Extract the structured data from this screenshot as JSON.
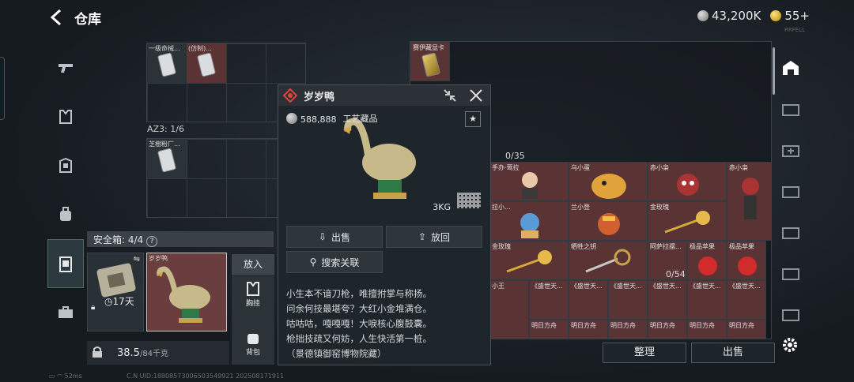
{
  "header": {
    "title": "仓库",
    "silver": "43,200K",
    "gold": "55+"
  },
  "nav": {
    "items": [
      "weapon-icon",
      "armor-icon",
      "vest-icon",
      "backpack-icon",
      "container-icon",
      "case-icon"
    ]
  },
  "containers": {
    "top_slot_labels": [
      "一级命械...",
      "(仿制)..."
    ],
    "az_capacity": "AZ3: 1/6",
    "mid_slot_label": "芝樹粉厂...",
    "safe_title": "安全箱: 4/4",
    "safe_help": "?",
    "safe_days": "17天",
    "duck_slot_label": "岁岁鸭",
    "put_label": "放入",
    "chest_label": "胸挂",
    "bag_label": "背包",
    "weight_value": "38.5",
    "weight_cap": "/84千克"
  },
  "popup": {
    "name": "岁岁鸭",
    "price": "588,888",
    "category": "工艺藏品",
    "star": "★",
    "weight": "3KG",
    "sell": "出售",
    "put_back": "放回",
    "search": "搜索关联",
    "desc": [
      "小生本不谙刀枪，唯擅拊掌与称扬。",
      "问余何技最堪夸？大红小金堆满仓。",
      "咕咕咕，嘎嘎嘎！大唳核心腹鼓囊。",
      "枪拙技疏又何妨，人生快活第一桩。",
      "（景德镇御窑博物院藏）"
    ]
  },
  "right_grid": {
    "top_label": "赛伊藏显卡",
    "count_a": "0/35",
    "count_b": "0/54",
    "row1": [
      "手办·莺拉",
      "乌小蛋",
      "赤小枭",
      "赤小枭"
    ],
    "row2": [
      "拉小...",
      "兰小登",
      "金玫瑰",
      ""
    ],
    "row3": [
      "金玫瑰",
      "牺牲之钥",
      "阿萨拉摆...",
      "极品苹果",
      "极品苹果"
    ],
    "row4": [
      "小王",
      "《盛世天...",
      "《盛世天...",
      "《盛世天...",
      "《盛世天...",
      "《盛世天..."
    ],
    "row5": [
      "明日方舟",
      "明日方舟",
      "明日方舟",
      "明日方舟",
      "明日方舟",
      "明日方舟"
    ]
  },
  "buttons": {
    "organize": "整理",
    "sell": "出售"
  },
  "status": {
    "ping": "52ms",
    "uid": "C.N UID:18808573006503549921 202508171911",
    "version": "RRFELL"
  },
  "colors": {
    "accent_gold": "#e6b94a",
    "rarity_red": "#6a3e3e",
    "popup_icon": "#e0443a"
  }
}
